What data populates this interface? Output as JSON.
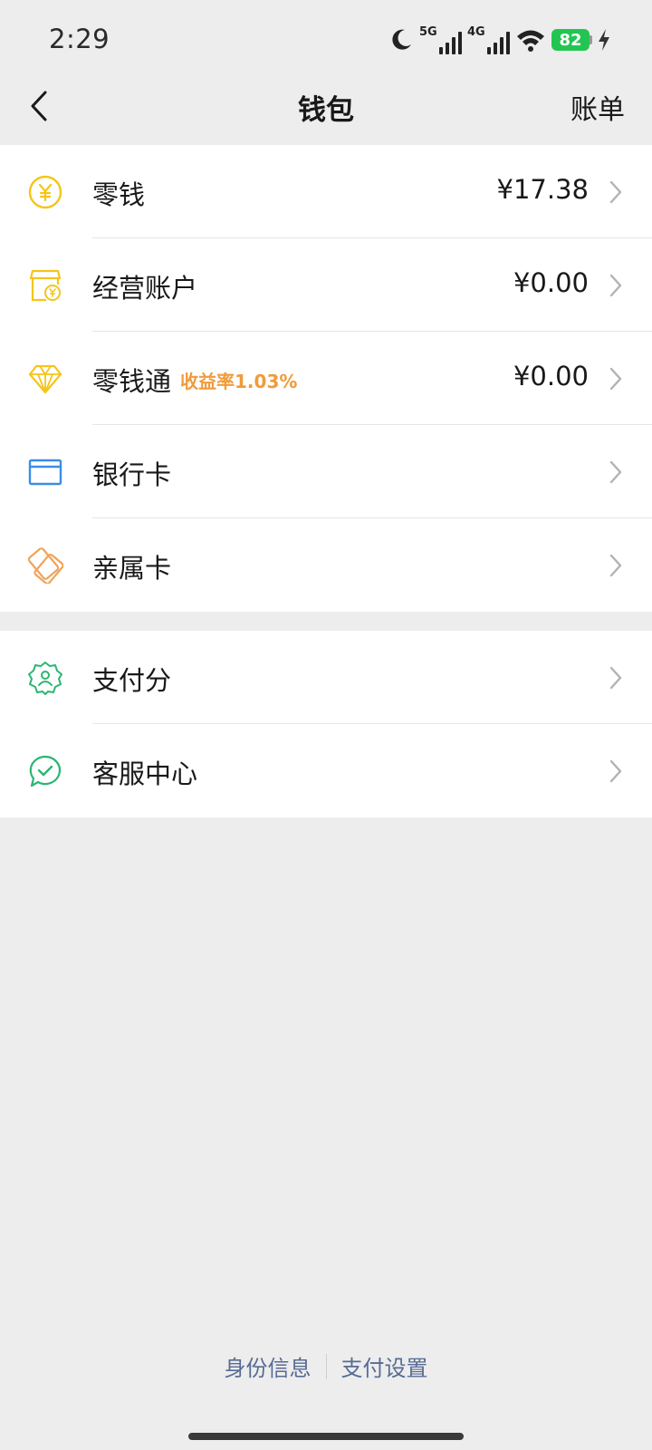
{
  "status_bar": {
    "time": "2:29",
    "net1": "5G",
    "net2": "4G",
    "battery": "82"
  },
  "nav": {
    "title": "钱包",
    "right_label": "账单"
  },
  "wallet_items": [
    {
      "label": "零钱",
      "value": "¥17.38",
      "icon": "yuan-coin-icon"
    },
    {
      "label": "经营账户",
      "value": "¥0.00",
      "icon": "shop-icon"
    },
    {
      "label": "零钱通",
      "tag": "收益率1.03%",
      "value": "¥0.00",
      "icon": "diamond-icon"
    },
    {
      "label": "银行卡",
      "icon": "bank-card-icon"
    },
    {
      "label": "亲属卡",
      "icon": "family-card-icon"
    }
  ],
  "service_items": [
    {
      "label": "支付分",
      "icon": "pay-score-icon"
    },
    {
      "label": "客服中心",
      "icon": "customer-service-icon"
    }
  ],
  "footer": {
    "link1": "身份信息",
    "link2": "支付设置"
  },
  "colors": {
    "background": "#ededed",
    "card": "#ffffff",
    "accent_orange": "#f09b3a",
    "link_blue": "#576b95",
    "icon_yellow": "#f5c518",
    "icon_blue": "#3a8ee6",
    "icon_orange": "#f0a35a",
    "icon_green": "#2bb673"
  }
}
